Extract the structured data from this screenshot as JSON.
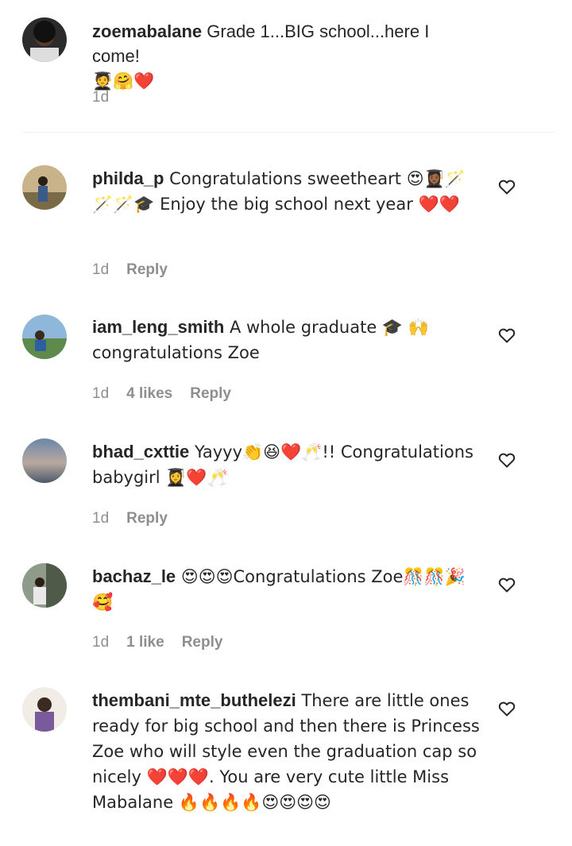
{
  "caption": {
    "username": "zoemabalane",
    "text": " Grade 1...BIG school...here I come!",
    "emoji_line": "🧑‍🎓🤗❤️",
    "time": "1d"
  },
  "comments": [
    {
      "username": "philda_p",
      "text": " Congratulations sweetheart 😍👩🏾‍🎓🪄🪄🪄🎓 Enjoy the big school next year ❤️❤️",
      "time": "1d",
      "likes": "",
      "reply": "Reply"
    },
    {
      "username": "iam_leng_smith",
      "text": " A whole graduate 🎓 🙌 congratulations Zoe",
      "time": "1d",
      "likes": "4 likes",
      "reply": "Reply"
    },
    {
      "username": "bhad_cxttie",
      "text": " Yayyy👏😆❤️🥂!! Congratulations babygirl 👩‍🎓❤️🥂",
      "time": "1d",
      "likes": "",
      "reply": "Reply"
    },
    {
      "username": "bachaz_le",
      "text": " 😍😍😍Congratulations Zoe🎊🎊🎉🥰",
      "time": "1d",
      "likes": "1 like",
      "reply": "Reply"
    },
    {
      "username": "thembani_mte_buthelezi",
      "text": " There are little ones ready for big school and then there is Princess Zoe who will style even the graduation cap so nicely ❤️❤️❤️. You are very cute little Miss Mabalane 🔥🔥🔥🔥😍😍😍😍",
      "time": "",
      "likes": "",
      "reply": ""
    }
  ],
  "icons": {
    "like": "heart-outline-icon"
  },
  "colors": {
    "meta": "#8e8e8e",
    "text": "#262626",
    "divider": "#efefef"
  }
}
